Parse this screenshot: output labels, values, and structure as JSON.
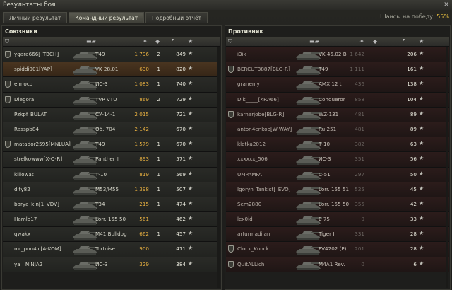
{
  "window": {
    "title": "Результаты боя"
  },
  "tabs": [
    {
      "label": "Личный результат",
      "active": false
    },
    {
      "label": "Командный результат",
      "active": true
    },
    {
      "label": "Подробный отчёт",
      "active": false
    }
  ],
  "win_chance": {
    "label": "Шансы на победу: ",
    "value": "55%"
  },
  "allies": {
    "title": "Союзники",
    "rows": [
      {
        "clan": true,
        "name": "ygara666[_TBCH]",
        "tank": "T49",
        "damage": "1 796",
        "kills": "2",
        "xp": "849"
      },
      {
        "clan": false,
        "name": "spiddi001[YAP]",
        "tank": "VK 28.01",
        "damage": "630",
        "kills": "1",
        "xp": "820",
        "highlight": true
      },
      {
        "clan": true,
        "name": "elmoco",
        "tank": "ИС-3",
        "damage": "1 083",
        "kills": "1",
        "xp": "740"
      },
      {
        "clan": true,
        "name": "Diegora",
        "tank": "TVP VTU",
        "damage": "869",
        "kills": "2",
        "xp": "729"
      },
      {
        "clan": false,
        "name": "Pzkpf_BULAT",
        "tank": "СУ-14-1",
        "damage": "2 015",
        "kills": "",
        "xp": "721"
      },
      {
        "clan": false,
        "name": "Rasspb84",
        "tank": "Об. 704",
        "damage": "2 142",
        "kills": "",
        "xp": "670"
      },
      {
        "clan": true,
        "name": "matador2595[MNLUA]",
        "tank": "T49",
        "damage": "1 579",
        "kills": "1",
        "xp": "670"
      },
      {
        "clan": false,
        "name": "strelkowww[X-O-R]",
        "tank": "Panther II",
        "damage": "893",
        "kills": "1",
        "xp": "571"
      },
      {
        "clan": false,
        "name": "killowat",
        "tank": "Т-10",
        "damage": "819",
        "kills": "1",
        "xp": "569"
      },
      {
        "clan": false,
        "name": "dity82",
        "tank": "M53/M55",
        "damage": "1 398",
        "kills": "1",
        "xp": "507"
      },
      {
        "clan": false,
        "name": "borya_kin[1_VDV]",
        "tank": "T34",
        "damage": "215",
        "kills": "1",
        "xp": "474"
      },
      {
        "clan": false,
        "name": "Hamlo17",
        "tank": "Lorr. 155 50",
        "damage": "561",
        "kills": "",
        "xp": "462"
      },
      {
        "clan": false,
        "name": "qwakx",
        "tank": "M41 Bulldog",
        "damage": "662",
        "kills": "1",
        "xp": "457"
      },
      {
        "clan": false,
        "name": "mr_pon4ic[A-KOM]",
        "tank": "Tortoise",
        "damage": "900",
        "kills": "",
        "xp": "411"
      },
      {
        "clan": false,
        "name": "ya__NINJA2",
        "tank": "ИС-3",
        "damage": "329",
        "kills": "",
        "xp": "384"
      }
    ]
  },
  "enemies": {
    "title": "Противник",
    "rows": [
      {
        "clan": false,
        "name": "i3ik",
        "tank": "VK 45.02 B",
        "damage": "1 642",
        "kills": "",
        "xp": "206"
      },
      {
        "clan": true,
        "name": "BERCUT3887[BLG-R]",
        "tank": "T49",
        "damage": "1 111",
        "kills": "",
        "xp": "161"
      },
      {
        "clan": false,
        "name": "graneniy",
        "tank": "AMX 12 t",
        "damage": "436",
        "kills": "",
        "xp": "138"
      },
      {
        "clan": false,
        "name": "Dik_____[KRA66]",
        "tank": "Conqueror",
        "damage": "858",
        "kills": "",
        "xp": "104"
      },
      {
        "clan": true,
        "name": "karnarjobe[BLG-R]",
        "tank": "WZ-131",
        "damage": "481",
        "kills": "",
        "xp": "89"
      },
      {
        "clan": false,
        "name": "anton4enkoo[W-WAY]",
        "tank": "Ru 251",
        "damage": "481",
        "kills": "",
        "xp": "89"
      },
      {
        "clan": false,
        "name": "kletka2012",
        "tank": "Т-10",
        "damage": "382",
        "kills": "",
        "xp": "63"
      },
      {
        "clan": false,
        "name": "xxxxxx_506",
        "tank": "ИС-3",
        "damage": "351",
        "kills": "",
        "xp": "56"
      },
      {
        "clan": false,
        "name": "UMPAMFA",
        "tank": "С-51",
        "damage": "297",
        "kills": "",
        "xp": "50"
      },
      {
        "clan": false,
        "name": "Igoryn_Tankist[_EVO]",
        "tank": "Lorr. 155 51",
        "damage": "525",
        "kills": "",
        "xp": "45"
      },
      {
        "clan": false,
        "name": "Sem2880",
        "tank": "Lorr. 155 50",
        "damage": "355",
        "kills": "",
        "xp": "42"
      },
      {
        "clan": false,
        "name": "lex0id",
        "tank": "E 75",
        "damage": "0",
        "kills": "",
        "xp": "33"
      },
      {
        "clan": false,
        "name": "arturmadilan",
        "tank": "Tiger II",
        "damage": "331",
        "kills": "",
        "xp": "28"
      },
      {
        "clan": true,
        "name": "Clock_Knock",
        "tank": "FV4202 (P)",
        "damage": "201",
        "kills": "",
        "xp": "28"
      },
      {
        "clan": true,
        "name": "QuitALLich",
        "tank": "M4A1 Rev.",
        "damage": "0",
        "kills": "",
        "xp": "6"
      }
    ]
  },
  "icons": {
    "clan": "clan-shield-icon",
    "tank_header": "tank-silhouette-icon",
    "damage_header": "damage-icon",
    "kills_header": "kills-icon",
    "xp_header": "star-icon"
  },
  "colors": {
    "accent": "#e8c040",
    "damage": "#e8b040",
    "highlight_row": "#4a3520"
  }
}
